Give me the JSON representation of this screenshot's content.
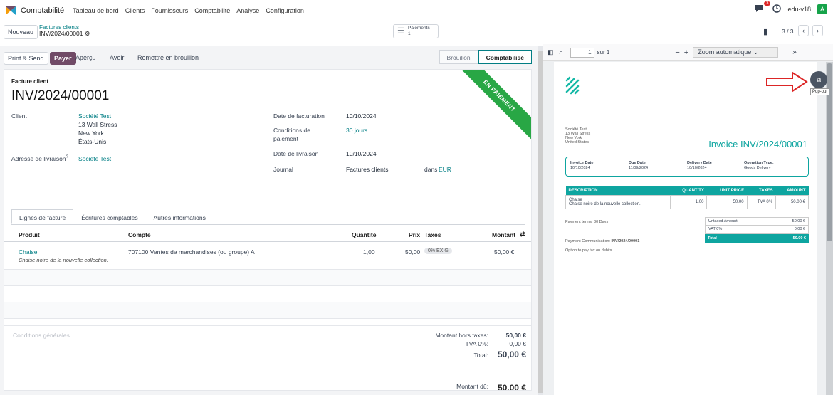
{
  "topbar": {
    "app_name": "Comptabilité",
    "menu": [
      "Tableau de bord",
      "Clients",
      "Fournisseurs",
      "Comptabilité",
      "Analyse",
      "Configuration"
    ],
    "chat_badge": "3",
    "db_name": "edu-v18",
    "avatar_letter": "A"
  },
  "control": {
    "new_label": "Nouveau",
    "breadcrumb_parent": "Factures clients",
    "breadcrumb_current": "INV/2024/00001",
    "payments_label": "Paiements",
    "payments_count": "1",
    "pager": "3 / 3"
  },
  "actions": {
    "print_send": "Print & Send",
    "pay": "Payer",
    "preview": "Aperçu",
    "credit": "Avoir",
    "reset": "Remettre en brouillon",
    "status_draft": "Brouillon",
    "status_posted": "Comptabilisé"
  },
  "invoice": {
    "type_label": "Facture client",
    "number": "INV/2024/00001",
    "ribbon": "EN PAIEMENT",
    "client_label": "Client",
    "client_name": "Société Test",
    "addr1": "13 Wall Stress",
    "addr2": "New York",
    "addr3": "États-Unis",
    "delivery_addr_label": "Adresse de livraison",
    "delivery_addr_sup": "?",
    "delivery_addr_val": "Société Test",
    "invoice_date_label": "Date de facturation",
    "invoice_date": "10/10/2024",
    "terms_label_1": "Conditions de",
    "terms_label_2": "paiement",
    "terms_val": "30 jours",
    "delivery_date_label": "Date de livraison",
    "delivery_date": "10/10/2024",
    "journal_label": "Journal",
    "journal_val": "Factures clients",
    "in_label": "dans",
    "currency": "EUR"
  },
  "tabs": [
    "Lignes de facture",
    "Écritures comptables",
    "Autres informations"
  ],
  "lines": {
    "headers": {
      "product": "Produit",
      "account": "Compte",
      "qty": "Quantité",
      "price": "Prix",
      "taxes": "Taxes",
      "amount": "Montant"
    },
    "rows": [
      {
        "product": "Chaise",
        "desc": "Chaise noire de la nouvelle collection.",
        "account": "707100 Ventes de marchandises (ou groupe) A",
        "qty": "1,00",
        "price": "50,00",
        "tax": "0% EX G",
        "amount": "50,00 €"
      }
    ]
  },
  "totals": {
    "terms_placeholder": "Conditions générales",
    "untaxed_label": "Montant hors taxes:",
    "untaxed_val": "50,00 €",
    "vat_label": "TVA 0%:",
    "vat_val": "0,00 €",
    "total_label": "Total:",
    "total_val": "50,00 €",
    "due_label": "Montant dû:",
    "due_val": "50,00 €"
  },
  "pdf": {
    "page_input": "1",
    "page_of": "sur 1",
    "zoom": "Zoom automatique",
    "popout_tooltip": "Pop-out",
    "customer": [
      "Société Test",
      "13 Wall Stress",
      "New York",
      "United States"
    ],
    "title": "Invoice INV/2024/00001",
    "info": [
      {
        "label": "Invoice Date",
        "value": "10/10/2024"
      },
      {
        "label": "Due Date",
        "value": "11/09/2024"
      },
      {
        "label": "Delivery Date",
        "value": "10/10/2024"
      },
      {
        "label": "Operation Type:",
        "value": "Goods Delivery"
      }
    ],
    "table_headers": [
      "DESCRIPTION",
      "QUANTITY",
      "UNIT PRICE",
      "TAXES",
      "AMOUNT"
    ],
    "table_row": {
      "desc1": "Chaise",
      "desc2": "Chaise noire de la nouvelle collection.",
      "qty": "1.00",
      "unit": "50.00",
      "taxes": "TVA 0%",
      "amount": "50.00 €"
    },
    "payment_terms": "Payment terms: 30 Days",
    "payment_comm_label": "Payment Communication:",
    "payment_comm_val": "INV/2024/00001",
    "tax_option": "Option to pay tax on debits",
    "summary": [
      {
        "label": "Untaxed Amount",
        "value": "50.00 €"
      },
      {
        "label": "VAT 0%",
        "value": "0.00 €"
      },
      {
        "label": "Total",
        "value": "50.00 €"
      }
    ]
  }
}
